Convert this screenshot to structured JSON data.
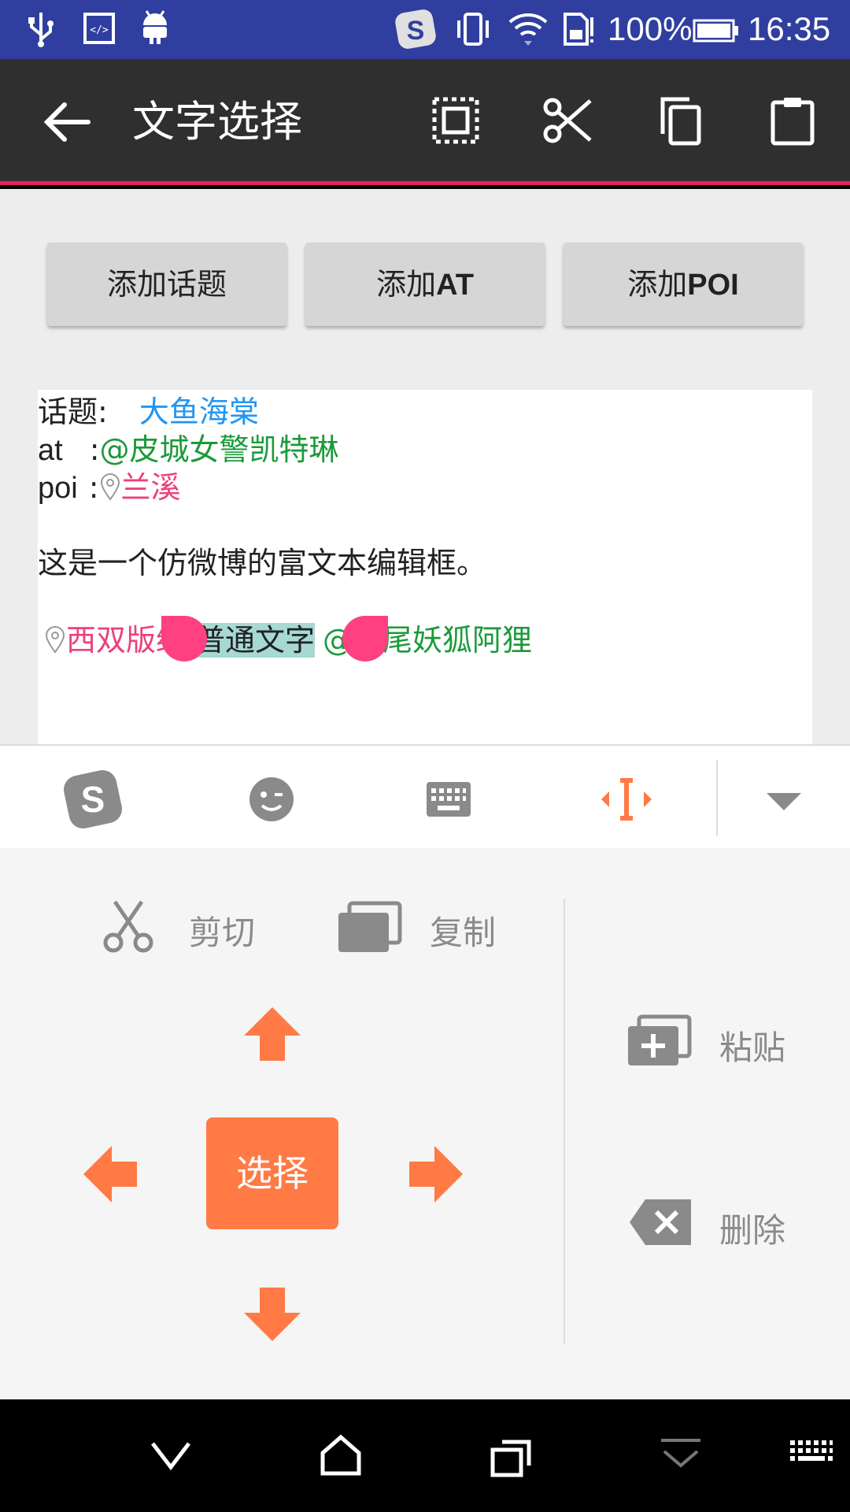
{
  "status_bar": {
    "battery_text": "100%",
    "time": "16:35",
    "icons": [
      "usb-icon",
      "code-icon",
      "android-icon",
      "sogou-icon",
      "vibrate-icon",
      "wifi-icon",
      "sim-icon",
      "battery-icon"
    ]
  },
  "toolbar": {
    "title": "文字选择",
    "actions": [
      "select-all-icon",
      "cut-icon",
      "copy-icon",
      "paste-icon"
    ]
  },
  "buttons": {
    "add_topic": "添加话题",
    "add_at_prefix": "添加",
    "add_at_suffix": "AT",
    "add_poi_prefix": "添加",
    "add_poi_suffix": "POI"
  },
  "editor": {
    "topic_label": "话题:",
    "topic_value": "大鱼海棠",
    "at_label": "at",
    "at_sep": ":",
    "at_value": "@皮城女警凯特琳",
    "poi_label": "poi",
    "poi_sep": ":",
    "poi_value": "兰溪",
    "sentence": "这是一个仿微博的富文本编辑框。",
    "mixed_poi": "西双版纳",
    "selected_text": "普通文字",
    "mixed_at": "@九尾妖狐阿狸"
  },
  "keyboard_bar": {
    "icons": [
      "sogou-logo-icon",
      "emoji-icon",
      "keyboard-icon",
      "cursor-select-icon",
      "collapse-icon"
    ]
  },
  "keyboard_panel": {
    "cut": "剪切",
    "copy": "复制",
    "paste": "粘贴",
    "delete": "删除",
    "select": "选择"
  },
  "colors": {
    "status_bar": "#303F9F",
    "toolbar": "#2f2f2f",
    "accent": "#e91e63",
    "topic": "#2196f3",
    "mention": "#1b9a3a",
    "poi": "#ec407a",
    "selection": "#a6d9d4",
    "keyboard_accent": "#ff7a45"
  }
}
